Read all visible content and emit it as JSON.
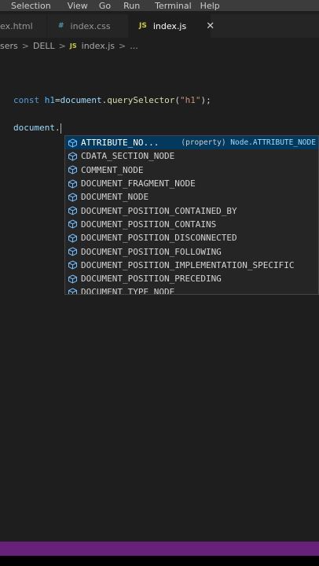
{
  "menubar": {
    "items": [
      "Selection",
      "View",
      "Go",
      "Run",
      "Terminal",
      "Help"
    ]
  },
  "tabs": [
    {
      "label": "ex.html",
      "icon": "html-icon",
      "active": false
    },
    {
      "label": "index.css",
      "icon_text": "#",
      "icon": "css-icon",
      "active": false
    },
    {
      "label": "index.js",
      "icon_text": "JS",
      "icon": "js-icon",
      "active": true,
      "close": "✕"
    }
  ],
  "breadcrumb": {
    "parts": [
      "sers",
      "DELL",
      "index.js",
      "..."
    ],
    "separator": ">",
    "js_icon": "JS"
  },
  "editor": {
    "line1": {
      "kw": "const",
      "var": "h1",
      "eq": "=",
      "obj": "document",
      "dot": ".",
      "fn": "querySelector",
      "open": "(",
      "str": "\"h1\"",
      "close": ");"
    },
    "line2": {
      "obj": "document",
      "dot": "."
    }
  },
  "suggest": {
    "items": [
      {
        "label": "ATTRIBUTE_NO...",
        "kind": "(property)",
        "detail": "Node.ATTRIBUTE_NODE",
        "selected": true
      },
      {
        "label": "CDATA_SECTION_NODE"
      },
      {
        "label": "COMMENT_NODE"
      },
      {
        "label": "DOCUMENT_FRAGMENT_NODE"
      },
      {
        "label": "DOCUMENT_NODE"
      },
      {
        "label": "DOCUMENT_POSITION_CONTAINED_BY"
      },
      {
        "label": "DOCUMENT_POSITION_CONTAINS"
      },
      {
        "label": "DOCUMENT_POSITION_DISCONNECTED"
      },
      {
        "label": "DOCUMENT_POSITION_FOLLOWING"
      },
      {
        "label": "DOCUMENT_POSITION_IMPLEMENTATION_SPECIFIC"
      },
      {
        "label": "DOCUMENT_POSITION_PRECEDING"
      },
      {
        "label": "DOCUMENT_TYPE_NODE"
      }
    ]
  },
  "colors": {
    "statusbar": "#68217a",
    "selection": "#04395e",
    "property_icon": "#75beff"
  }
}
